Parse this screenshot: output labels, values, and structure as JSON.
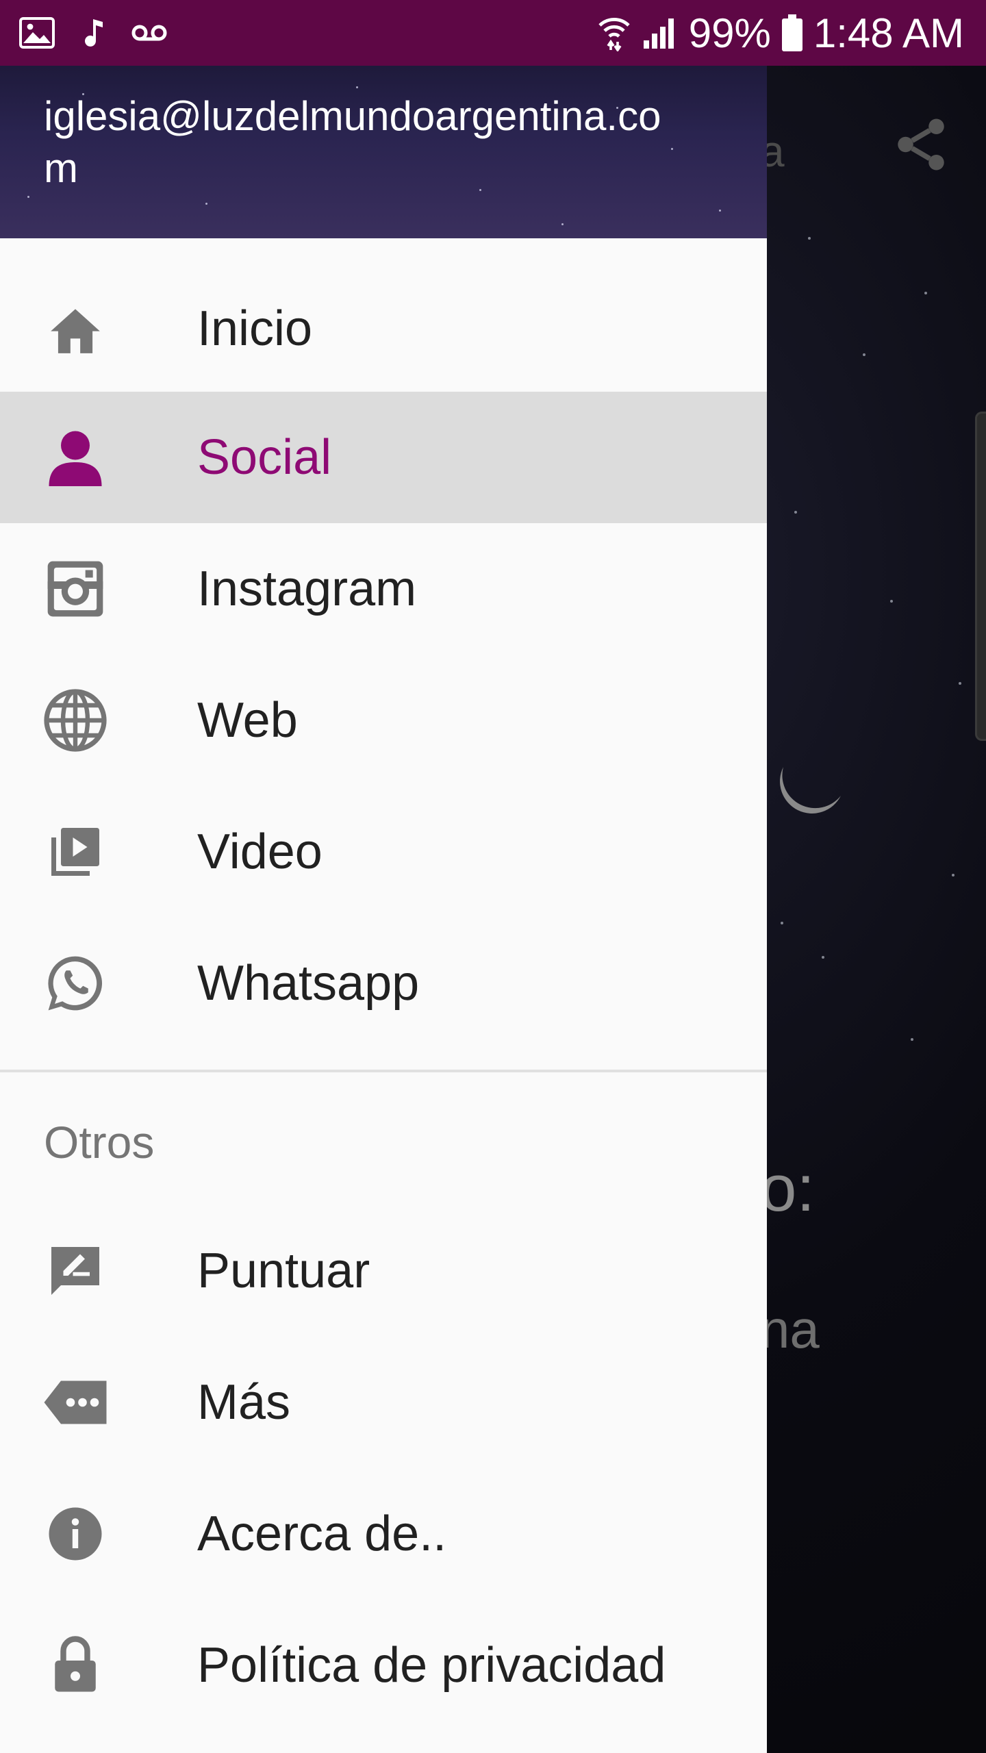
{
  "status_bar": {
    "battery": "99%",
    "time": "1:48 AM"
  },
  "background_app": {
    "title_fragment": "a",
    "text_line1": "o:",
    "text_line2": "na"
  },
  "drawer": {
    "email": "iglesia@luzdelmundoargentina.com",
    "main_items": [
      {
        "label": "Inicio",
        "icon": "home-icon"
      },
      {
        "label": "Social",
        "icon": "person-icon",
        "selected": true
      },
      {
        "label": "Instagram",
        "icon": "instagram-icon"
      },
      {
        "label": "Web",
        "icon": "globe-icon"
      },
      {
        "label": "Video",
        "icon": "video-library-icon"
      },
      {
        "label": "Whatsapp",
        "icon": "whatsapp-icon"
      }
    ],
    "section_title": "Otros",
    "other_items": [
      {
        "label": "Puntuar",
        "icon": "rate-review-icon"
      },
      {
        "label": "Más",
        "icon": "more-label-icon"
      },
      {
        "label": "Acerca de..",
        "icon": "info-icon"
      },
      {
        "label": "Política de privacidad",
        "icon": "lock-icon"
      }
    ]
  },
  "colors": {
    "status_bar": "#5e0745",
    "accent": "#8e0a74",
    "selected_bg": "#dcdcdc",
    "icon_gray": "#757575"
  }
}
